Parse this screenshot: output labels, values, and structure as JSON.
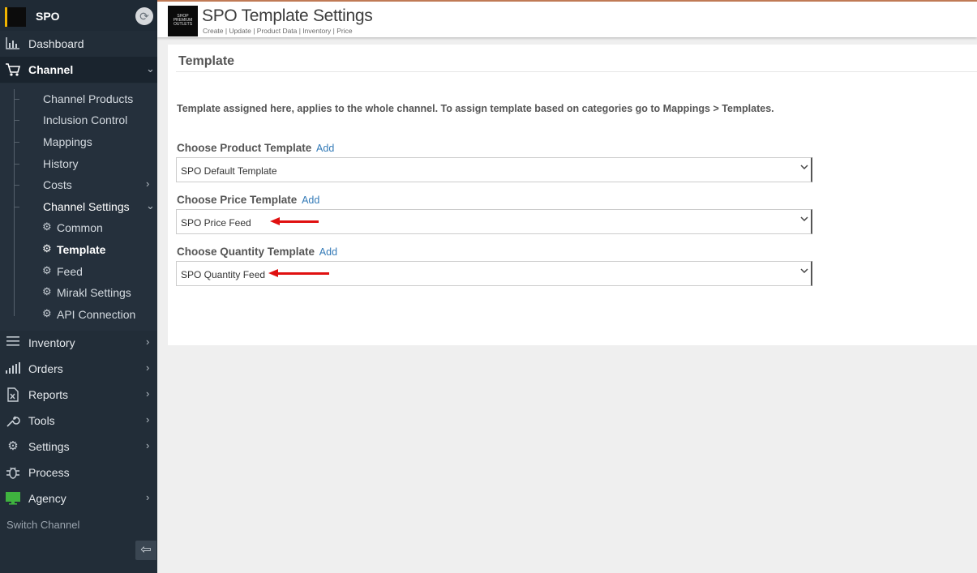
{
  "sidebar": {
    "brand": "SPO",
    "nav": {
      "dashboard": "Dashboard",
      "channel": "Channel",
      "inventory": "Inventory",
      "orders": "Orders",
      "reports": "Reports",
      "tools": "Tools",
      "settings": "Settings",
      "process": "Process",
      "agency": "Agency"
    },
    "channel_items": {
      "channel_products": "Channel Products",
      "inclusion_control": "Inclusion Control",
      "mappings": "Mappings",
      "history": "History",
      "costs": "Costs",
      "channel_settings": "Channel Settings"
    },
    "channel_settings_items": {
      "common": "Common",
      "template": "Template",
      "feed": "Feed",
      "mirakl_settings": "Mirakl Settings",
      "api_connection": "API Connection"
    },
    "switch_channel": "Switch Channel"
  },
  "header": {
    "logo_text": "SHOP PREMIUM OUTLETS",
    "title": "SPO Template Settings",
    "subtitle": "Create | Update | Product Data | Inventory | Price"
  },
  "main": {
    "section_title": "Template",
    "note": "Template assigned here, applies to the whole channel. To assign template based on categories go to Mappings > Templates.",
    "add_label": "Add",
    "fields": {
      "product": {
        "label": "Choose Product Template",
        "value": "SPO Default Template"
      },
      "price": {
        "label": "Choose Price Template",
        "value": "SPO Price Feed"
      },
      "quantity": {
        "label": "Choose Quantity Template",
        "value": "SPO Quantity Feed"
      }
    }
  },
  "colors": {
    "sidebar_bg": "#222d38",
    "accent_link": "#337ab7",
    "annotation_arrow": "#e01010",
    "brand_accent": "#f0b400"
  },
  "icons": {
    "dashboard": "bar-chart-icon",
    "channel": "cart-icon",
    "inventory": "menu-lines-icon",
    "orders": "signal-bars-icon",
    "reports": "excel-file-icon",
    "tools": "wrench-icon",
    "settings": "gear-icon",
    "process": "bug-icon",
    "agency": "monitor-icon"
  }
}
